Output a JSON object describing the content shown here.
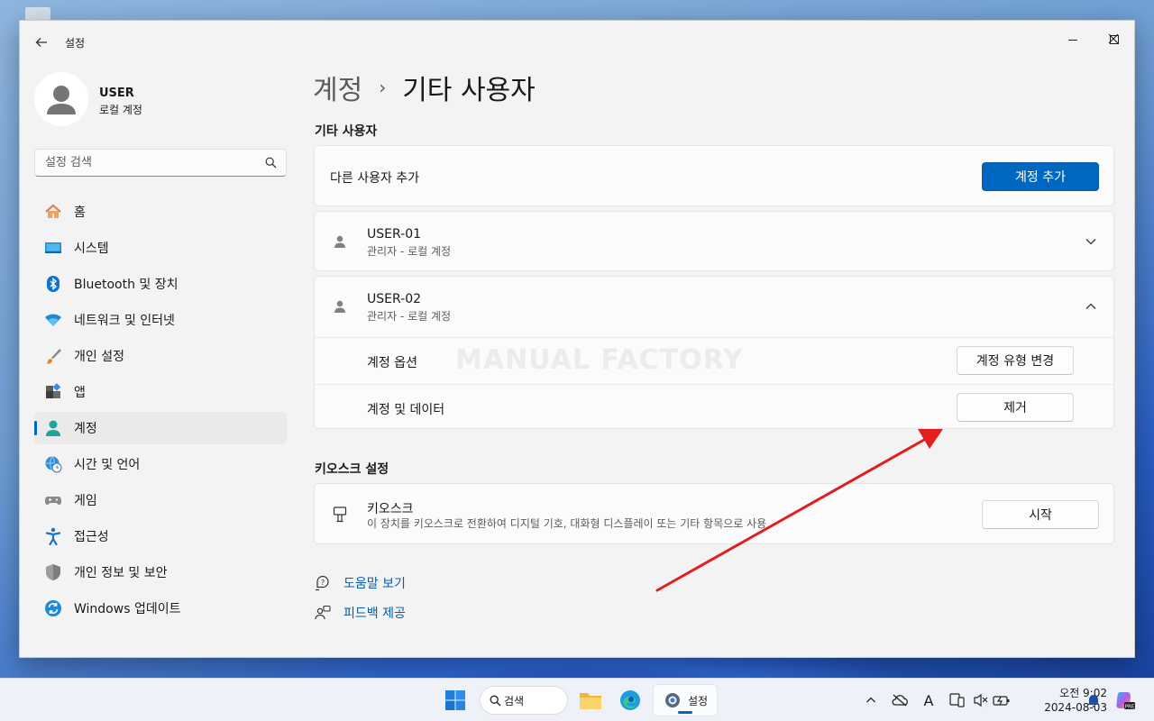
{
  "window": {
    "app_title": "설정"
  },
  "profile": {
    "name": "USER",
    "account_type": "로컬 계정"
  },
  "search": {
    "placeholder": "설정 검색"
  },
  "sidebar": {
    "items": [
      {
        "label": "홈",
        "icon": "home-icon"
      },
      {
        "label": "시스템",
        "icon": "monitor-icon"
      },
      {
        "label": "Bluetooth 및 장치",
        "icon": "bluetooth-icon"
      },
      {
        "label": "네트워크 및 인터넷",
        "icon": "wifi-icon"
      },
      {
        "label": "개인 설정",
        "icon": "brush-icon"
      },
      {
        "label": "앱",
        "icon": "apps-icon"
      },
      {
        "label": "계정",
        "icon": "account-icon",
        "active": true
      },
      {
        "label": "시간 및 언어",
        "icon": "globe-clock-icon"
      },
      {
        "label": "게임",
        "icon": "gamepad-icon"
      },
      {
        "label": "접근성",
        "icon": "accessibility-icon"
      },
      {
        "label": "개인 정보 및 보안",
        "icon": "shield-icon"
      },
      {
        "label": "Windows 업데이트",
        "icon": "update-icon"
      }
    ]
  },
  "breadcrumb": {
    "parent": "계정",
    "separator": "›",
    "current": "기타 사용자"
  },
  "other_users": {
    "section_title": "기타 사용자",
    "add_label": "다른 사용자 추가",
    "add_button": "계정 추가",
    "users": [
      {
        "name": "USER-01",
        "subtitle": "관리자 - 로컬 계정",
        "expanded": false
      },
      {
        "name": "USER-02",
        "subtitle": "관리자 - 로컬 계정",
        "expanded": true
      }
    ],
    "account_options_label": "계정 옵션",
    "change_type_button": "계정 유형 변경",
    "account_data_label": "계정 및 데이터",
    "remove_button": "제거"
  },
  "watermark": "MANUAL FACTORY",
  "kiosk": {
    "section_title": "키오스크 설정",
    "title": "키오스크",
    "description": "이 장치를 키오스크로 전환하여 디지털 기호, 대화형 디스플레이 또는 기타 항목으로 사용",
    "start_button": "시작"
  },
  "links": {
    "help": "도움말 보기",
    "feedback": "피드백 제공"
  },
  "taskbar": {
    "search_label": "검색",
    "settings_label": "설정",
    "time": "오전 9:02",
    "date": "2024-08-03"
  },
  "colors": {
    "accent": "#0067c0",
    "annotation_arrow": "#e02020"
  }
}
